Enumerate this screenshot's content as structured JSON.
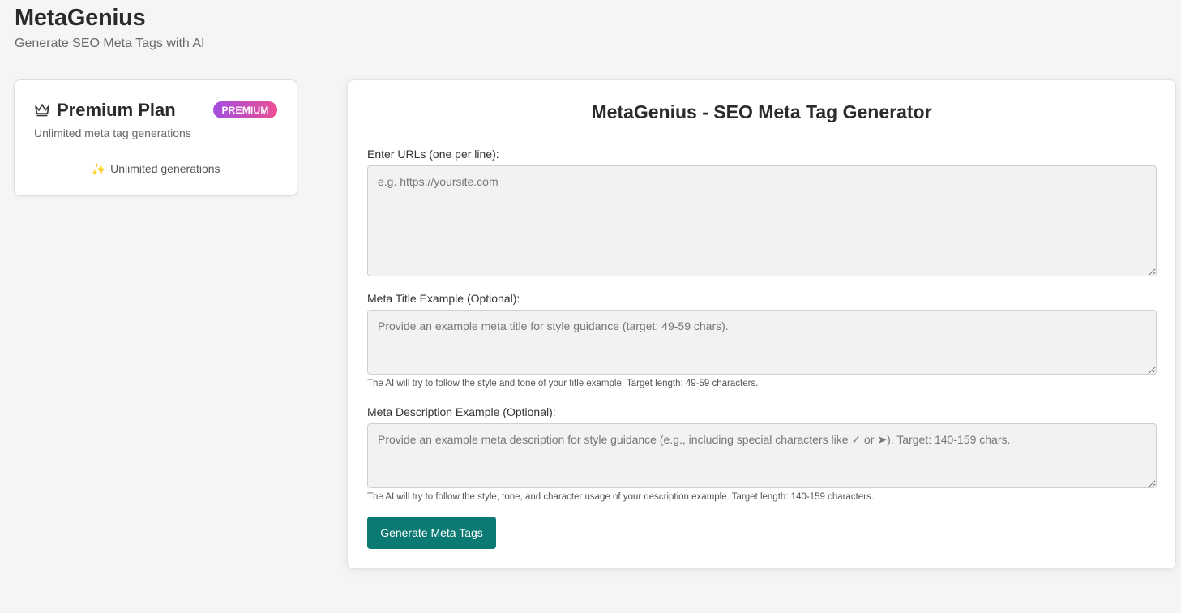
{
  "header": {
    "title": "MetaGenius",
    "subtitle": "Generate SEO Meta Tags with AI"
  },
  "plan": {
    "icon": "crown-icon",
    "name": "Premium Plan",
    "badge": "PREMIUM",
    "description": "Unlimited meta tag generations",
    "feature_icon": "sparkle-icon",
    "feature": "Unlimited generations",
    "badge_gradient": [
      "#a24ee0",
      "#ec4f93"
    ]
  },
  "generator": {
    "title": "MetaGenius - SEO Meta Tag Generator",
    "urls": {
      "label": "Enter URLs (one per line):",
      "placeholder": "e.g. https://yoursite.com",
      "value": ""
    },
    "meta_title": {
      "label": "Meta Title Example (Optional):",
      "placeholder": "Provide an example meta title for style guidance (target: 49-59 chars).",
      "value": "",
      "help": "The AI will try to follow the style and tone of your title example. Target length: 49-59 characters."
    },
    "meta_description": {
      "label": "Meta Description Example (Optional):",
      "placeholder": "Provide an example meta description for style guidance (e.g., including special characters like ✓ or ➤). Target: 140-159 chars.",
      "value": "",
      "help": "The AI will try to follow the style, tone, and character usage of your description example. Target length: 140-159 characters."
    },
    "button_label": "Generate Meta Tags",
    "accent_color": "#0b7a72"
  }
}
